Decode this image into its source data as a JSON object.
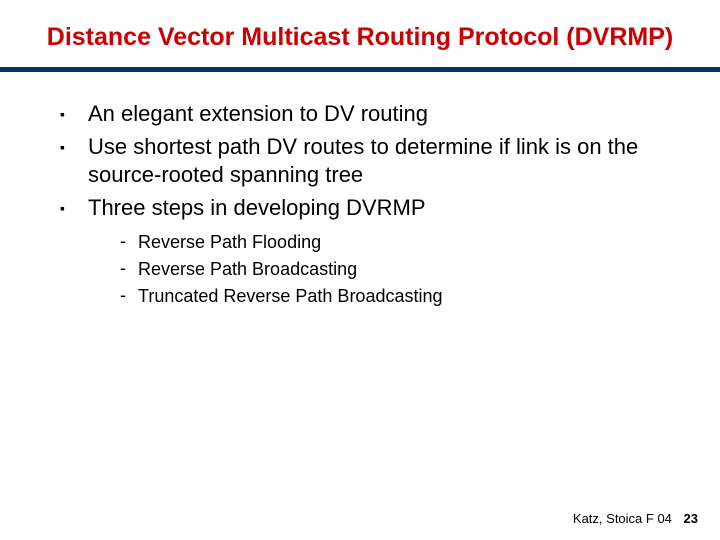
{
  "title": "Distance Vector Multicast Routing Protocol (DVRMP)",
  "bullets": {
    "b0": "An elegant extension to DV routing",
    "b1": "Use shortest path DV routes to determine if link is on the source-rooted spanning tree",
    "b2": "Three steps in developing DVRMP"
  },
  "subbullets": {
    "s0": "Reverse Path Flooding",
    "s1": "Reverse Path Broadcasting",
    "s2": "Truncated Reverse Path Broadcasting"
  },
  "footer": {
    "credit": "Katz, Stoica F 04",
    "page": "23"
  }
}
